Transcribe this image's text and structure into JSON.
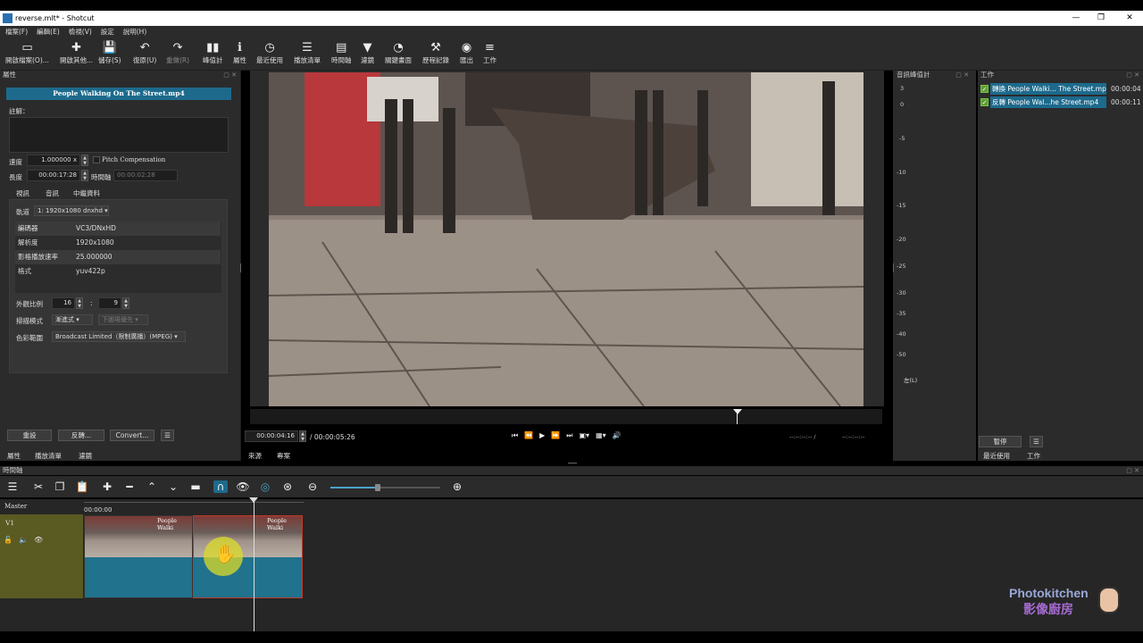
{
  "window": {
    "title": "reverse.mlt* - Shotcut",
    "minimize": "—",
    "maximize": "❐",
    "close": "✕"
  },
  "menu": [
    "檔案(F)",
    "編輯(E)",
    "檢視(V)",
    "設定",
    "說明(H)"
  ],
  "toolbar": [
    {
      "icon": "folder-open-icon",
      "glyph": "▭",
      "label": "開啟檔案(O)..."
    },
    {
      "icon": "open-other-icon",
      "glyph": "✚",
      "label": "開啟其他..."
    },
    {
      "icon": "save-icon",
      "glyph": "💾",
      "label": "儲存(S)"
    },
    {
      "icon": "undo-icon",
      "glyph": "↶",
      "label": "復原(U)"
    },
    {
      "icon": "redo-icon",
      "glyph": "↷",
      "label": "重做(R)"
    },
    {
      "icon": "peak-meter-icon",
      "glyph": "▮▮",
      "label": "峰值計"
    },
    {
      "icon": "properties-icon",
      "glyph": "ℹ",
      "label": "屬性"
    },
    {
      "icon": "recent-icon",
      "glyph": "◷",
      "label": "最近使用"
    },
    {
      "icon": "playlist-icon",
      "glyph": "☰",
      "label": "播放清單"
    },
    {
      "icon": "timeline-icon",
      "glyph": "▤",
      "label": "時間軸"
    },
    {
      "icon": "filter-icon",
      "glyph": "▼",
      "label": "濾鏡"
    },
    {
      "icon": "keyframes-icon",
      "glyph": "◔",
      "label": "關鍵畫面"
    },
    {
      "icon": "history-icon",
      "glyph": "⚒",
      "label": "歷程記錄"
    },
    {
      "icon": "export-icon",
      "glyph": "◉",
      "label": "匯出"
    },
    {
      "icon": "jobs-icon",
      "glyph": "≡",
      "label": "工作"
    }
  ],
  "properties": {
    "header": "屬性",
    "clip_name": "People Walking On The Street.mp4",
    "comments_label": "註解：",
    "speed_label": "速度",
    "speed_value": "1.000000 x",
    "pitch_label": "Pitch Compensation",
    "duration_label": "長度",
    "duration_value": "00:00:17:28",
    "timeline_label": "時間軸",
    "timeline_value": "00:00:02:28",
    "tabs": [
      "視訊",
      "音訊",
      "中繼資料"
    ],
    "track_label": "軌道",
    "track_value": "1: 1920x1080 dnxhd",
    "rows": [
      {
        "k": "編碼器",
        "v": "VC3/DNxHD"
      },
      {
        "k": "解析度",
        "v": "1920x1080"
      },
      {
        "k": "影格播放速率",
        "v": "25.000000"
      },
      {
        "k": "格式",
        "v": "yuv422p"
      }
    ],
    "aspect_label": "外觀比例",
    "aspect_w": "16",
    "aspect_sep": ":",
    "aspect_h": "9",
    "scan_label": "掃描模式",
    "scan_value": "漸進式",
    "field_value": "下圖場優先",
    "color_label": "色彩範圍",
    "color_value": "Broadcast Limited（限制廣播）(MPEG)",
    "reset_button": "重設",
    "reverse_button": "反轉...",
    "convert_button": "Convert...",
    "menu_button": "☰"
  },
  "left_tabs": [
    "屬性",
    "播放清單",
    "濾鏡"
  ],
  "viewer": {
    "timecode": "00:00:04:16",
    "duration": "/ 00:00:05:26",
    "in_point": "--:--:--:-- /",
    "out_point": "--:--:--:--",
    "tabs": [
      "來源",
      "專案"
    ]
  },
  "meter": {
    "header": "音訊峰值計",
    "ticks": [
      "3",
      "0",
      "-5",
      "-10",
      "-15",
      "-20",
      "-25",
      "-30",
      "-35",
      "-40",
      "-50"
    ],
    "channel_label": "左(L)"
  },
  "jobs": {
    "header": "工作",
    "items": [
      {
        "name": "轉換 People Walki... The Street.mp4",
        "time": "00:00:04"
      },
      {
        "name": "反轉 People Wal...he Street.mp4",
        "time": "00:00:11"
      }
    ],
    "pause_button": "暫停",
    "menu_button": "☰",
    "tabs": [
      "最近使用",
      "工作"
    ]
  },
  "timeline": {
    "header": "時間軸",
    "master_label": "Master",
    "track_name": "V1",
    "ruler_start": "00:00:00",
    "clip1_name": "People Walki",
    "clip2_name": "People Walki"
  },
  "watermark": {
    "line1": "Photokitchen",
    "line2": "影像廚房"
  }
}
